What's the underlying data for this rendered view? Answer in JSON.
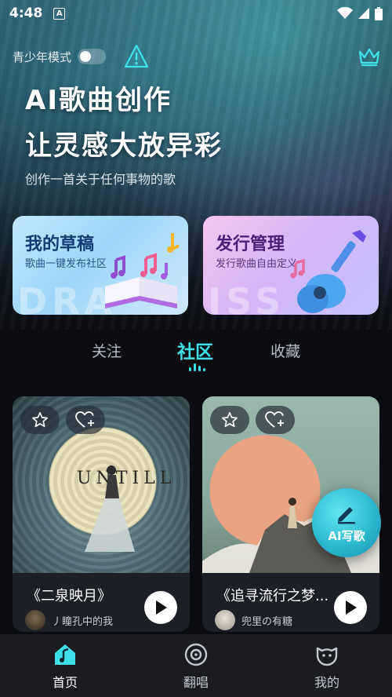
{
  "status_bar": {
    "time": "4:48",
    "badge": "A"
  },
  "top_bar": {
    "teen_mode_label": "青少年模式"
  },
  "hero": {
    "title_line1": "AI歌曲创作",
    "title_line2": "让灵感大放异彩",
    "subtitle": "创作一首关于任何事物的歌"
  },
  "cards": {
    "drafts": {
      "title": "我的草稿",
      "subtitle": "歌曲一键发布社区",
      "watermark": "DRA"
    },
    "publish": {
      "title": "发行管理",
      "subtitle": "发行歌曲自由定义",
      "watermark": "ISS"
    }
  },
  "tabs": {
    "follow": "关注",
    "community": "社区",
    "favorites": "收藏",
    "active": "社区"
  },
  "songs": [
    {
      "title": "《二泉映月》",
      "author": "丿瞳孔中的我",
      "cover_text": "UNTILL"
    },
    {
      "title": "《追寻流行之梦...",
      "author": "兜里の有糖"
    }
  ],
  "fab": {
    "label": "AI写歌"
  },
  "bottom_nav": {
    "home": "首页",
    "cover": "翻唱",
    "me": "我的"
  },
  "colors": {
    "accent": "#3fe0e8",
    "nav_bg": "#1b1c22"
  }
}
